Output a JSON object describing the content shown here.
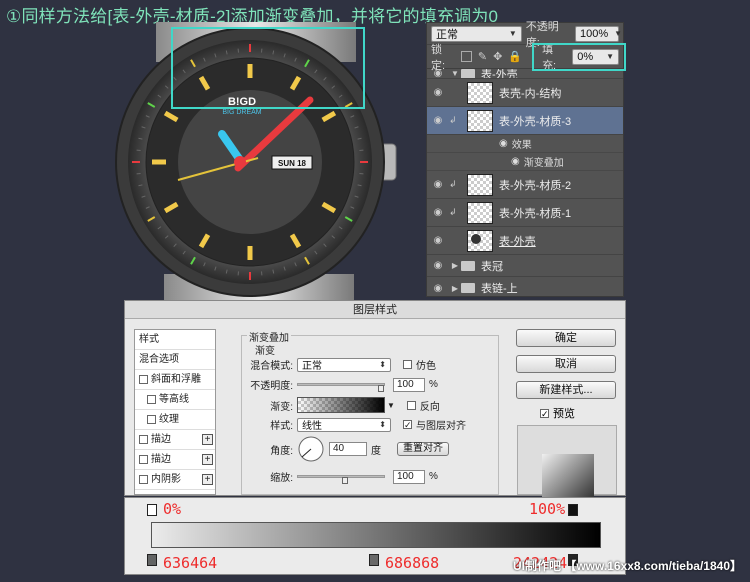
{
  "heading": "①同样方法给[表-外壳-材质-2]添加渐变叠加，并将它的填充调为0",
  "watch": {
    "brand": "B!GD",
    "brand_sub": "BIG DREAM",
    "date": "SUN 18"
  },
  "layers": {
    "blend": "正常",
    "opacity_label": "不透明度:",
    "opacity_value": "100%",
    "lock_label": "锁定:",
    "fill_label": "填充:",
    "fill_value": "0%",
    "rows": [
      {
        "name": "表-外壳"
      },
      {
        "name": "表壳-内-结构"
      },
      {
        "name": "表-外壳-材质-3"
      },
      {
        "name": "效果"
      },
      {
        "name": "渐变叠加"
      },
      {
        "name": "表-外壳-材质-2"
      },
      {
        "name": "表-外壳-材质-1"
      },
      {
        "name": "表-外壳"
      },
      {
        "name": "表冠"
      },
      {
        "name": "表链-上"
      }
    ]
  },
  "dialog": {
    "title": "图层样式",
    "styles": [
      "样式",
      "混合选项",
      "斜面和浮雕",
      "等高线",
      "纹理",
      "描边",
      "描边",
      "内阴影"
    ],
    "section": "渐变叠加",
    "subsection": "渐变",
    "blend_label": "混合模式:",
    "blend_value": "正常",
    "dither_label": "仿色",
    "opacity_label": "不透明度:",
    "opacity_value": "100",
    "pct": "%",
    "gradient_label": "渐变:",
    "reverse_label": "反向",
    "style_label": "样式:",
    "style_value": "线性",
    "align_label": "与图层对齐",
    "angle_label": "角度:",
    "angle_value": "40",
    "degree": "度",
    "reset_align": "重置对齐",
    "scale_label": "缩放:",
    "scale_value": "100",
    "ok": "确定",
    "cancel": "取消",
    "new_style": "新建样式...",
    "preview": "预览"
  },
  "gradient": {
    "left_opacity": "0%",
    "right_opacity": "100%",
    "left_color": "636464",
    "mid_color": "686868",
    "right_color": "242424"
  },
  "watermark": "UI制作吧  【www.16xx8.com/tieba/1840】",
  "colors": {
    "accent_box": "#40d7c8",
    "annotation": "#ee2c2c",
    "heading": "#7fe3ba"
  }
}
